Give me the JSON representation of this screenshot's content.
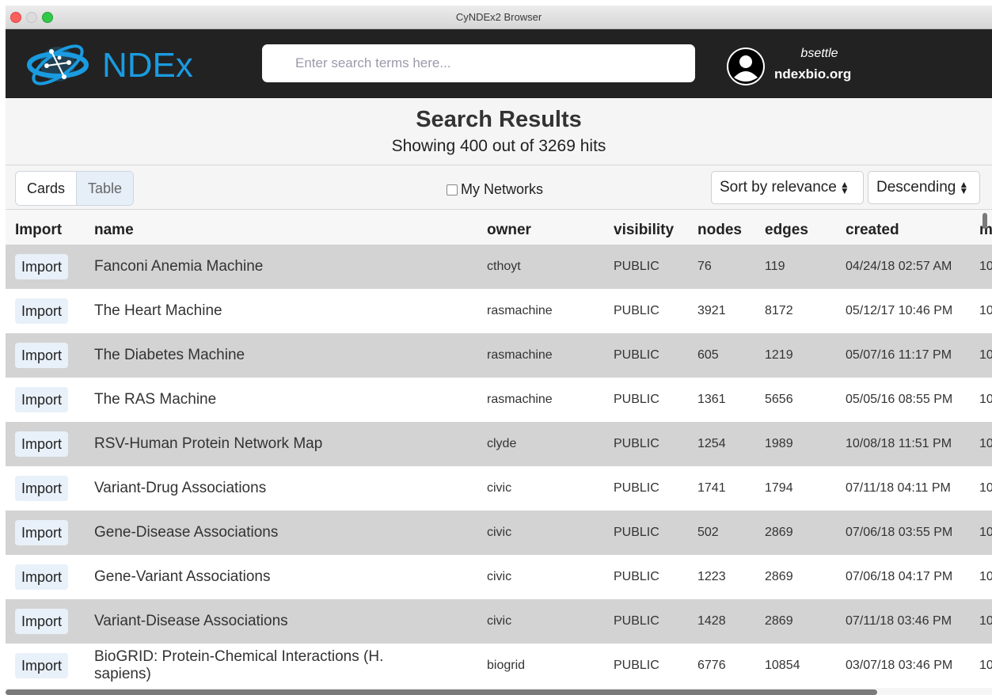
{
  "window": {
    "title": "CyNDEx2 Browser"
  },
  "header": {
    "logo_text": "NDEx",
    "search": {
      "placeholder": "Enter search terms here...",
      "value": ""
    },
    "user": {
      "name": "bsettle",
      "host": "ndexbio.org"
    }
  },
  "results": {
    "title": "Search Results",
    "subtitle": "Showing 400 out of 3269 hits"
  },
  "toolbar": {
    "view_cards": "Cards",
    "view_table": "Table",
    "active_view": "Table",
    "my_networks_label": "My Networks",
    "my_networks_checked": false,
    "sort_by": "Sort by relevance",
    "order": "Descending"
  },
  "table": {
    "columns": {
      "import": "Import",
      "name": "name",
      "owner": "owner",
      "visibility": "visibility",
      "nodes": "nodes",
      "edges": "edges",
      "created": "created",
      "modified": "m"
    },
    "import_label": "Import",
    "rows": [
      {
        "name": "Fanconi Anemia Machine",
        "owner": "cthoyt",
        "visibility": "PUBLIC",
        "nodes": "76",
        "edges": "119",
        "created": "04/24/18 02:57 AM",
        "modified": "10"
      },
      {
        "name": "The Heart Machine",
        "owner": "rasmachine",
        "visibility": "PUBLIC",
        "nodes": "3921",
        "edges": "8172",
        "created": "05/12/17 10:46 PM",
        "modified": "10"
      },
      {
        "name": "The Diabetes Machine",
        "owner": "rasmachine",
        "visibility": "PUBLIC",
        "nodes": "605",
        "edges": "1219",
        "created": "05/07/16 11:17 PM",
        "modified": "10"
      },
      {
        "name": "The RAS Machine",
        "owner": "rasmachine",
        "visibility": "PUBLIC",
        "nodes": "1361",
        "edges": "5656",
        "created": "05/05/16 08:55 PM",
        "modified": "10"
      },
      {
        "name": "RSV-Human Protein Network Map",
        "owner": "clyde",
        "visibility": "PUBLIC",
        "nodes": "1254",
        "edges": "1989",
        "created": "10/08/18 11:51 PM",
        "modified": "10"
      },
      {
        "name": "Variant-Drug Associations",
        "owner": "civic",
        "visibility": "PUBLIC",
        "nodes": "1741",
        "edges": "1794",
        "created": "07/11/18 04:11 PM",
        "modified": "10"
      },
      {
        "name": "Gene-Disease Associations",
        "owner": "civic",
        "visibility": "PUBLIC",
        "nodes": "502",
        "edges": "2869",
        "created": "07/06/18 03:55 PM",
        "modified": "10"
      },
      {
        "name": "Gene-Variant Associations",
        "owner": "civic",
        "visibility": "PUBLIC",
        "nodes": "1223",
        "edges": "2869",
        "created": "07/06/18 04:17 PM",
        "modified": "10"
      },
      {
        "name": "Variant-Disease Associations",
        "owner": "civic",
        "visibility": "PUBLIC",
        "nodes": "1428",
        "edges": "2869",
        "created": "07/11/18 03:46 PM",
        "modified": "10"
      },
      {
        "name": "BioGRID: Protein-Chemical Interactions (H. sapiens)",
        "owner": "biogrid",
        "visibility": "PUBLIC",
        "nodes": "6776",
        "edges": "10854",
        "created": "03/07/18 03:46 PM",
        "modified": "10"
      }
    ]
  },
  "colors": {
    "header_bg": "#222222",
    "logo_blue": "#1a9be0",
    "row_shaded": "#d3d3d3",
    "button_bg": "#e8f0f9"
  }
}
